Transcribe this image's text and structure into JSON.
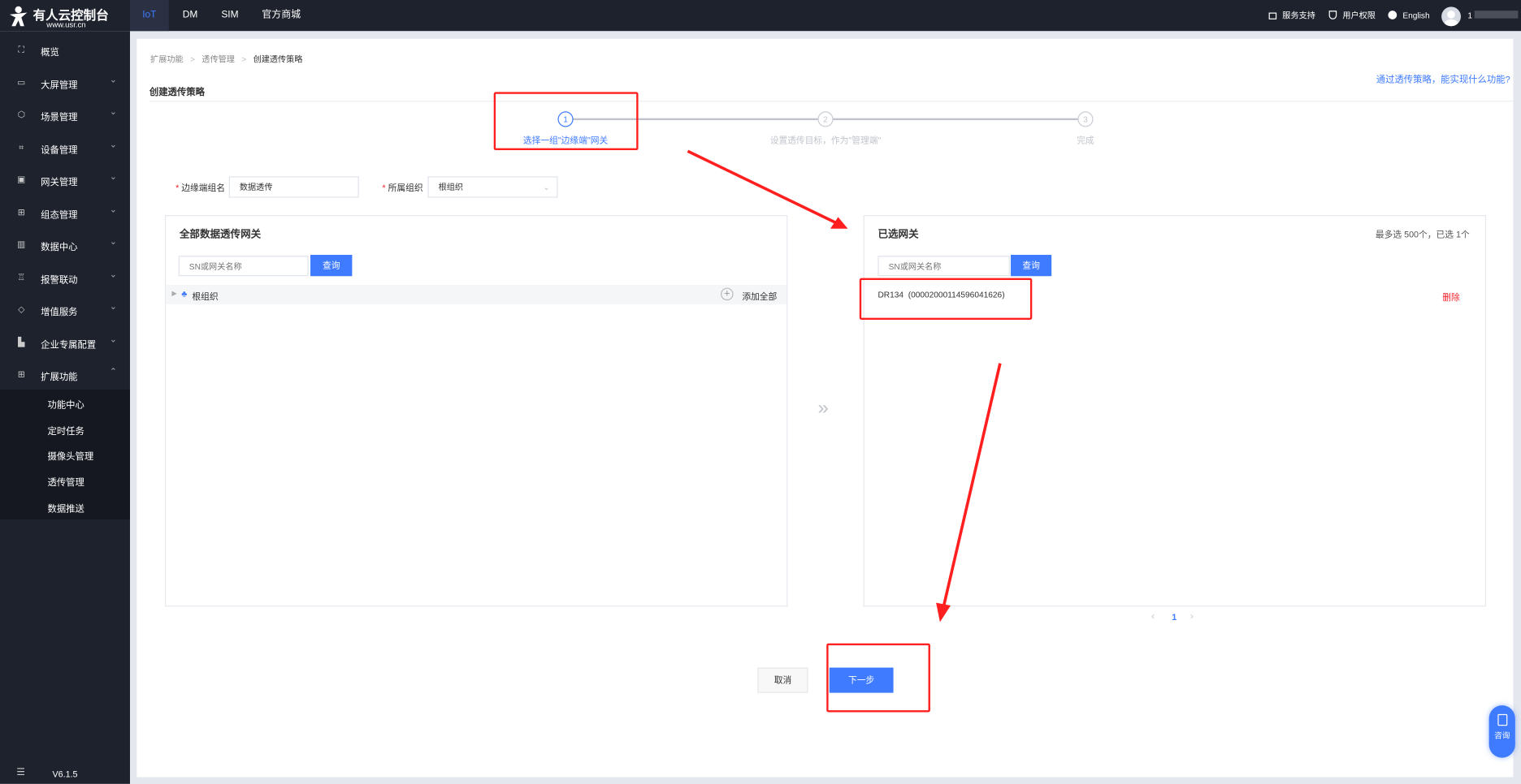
{
  "header": {
    "logo_title": "有人云控制台",
    "logo_url_text": "www.usr.cn",
    "nav": [
      "IoT",
      "DM",
      "SIM",
      "官方商城"
    ],
    "active_nav": "IoT",
    "support": "服务支持",
    "permissions": "用户权限",
    "language": "English",
    "user": "1"
  },
  "sidebar": {
    "items": [
      {
        "label": "概览",
        "icon": "overview-icon"
      },
      {
        "label": "大屏管理",
        "icon": "screen-icon"
      },
      {
        "label": "场景管理",
        "icon": "cube-icon"
      },
      {
        "label": "设备管理",
        "icon": "device-icon"
      },
      {
        "label": "网关管理",
        "icon": "gateway-icon"
      },
      {
        "label": "组态管理",
        "icon": "topology-icon"
      },
      {
        "label": "数据中心",
        "icon": "chart-icon"
      },
      {
        "label": "报警联动",
        "icon": "alarm-icon"
      },
      {
        "label": "增值服务",
        "icon": "diamond-icon"
      },
      {
        "label": "企业专属配置",
        "icon": "building-icon"
      },
      {
        "label": "扩展功能",
        "icon": "grid-icon"
      }
    ],
    "submenu": [
      "功能中心",
      "定时任务",
      "摄像头管理",
      "透传管理",
      "数据推送"
    ],
    "version": "V6.1.5"
  },
  "breadcrumb": [
    "扩展功能",
    "透传管理",
    "创建透传策略"
  ],
  "page_title": "创建透传策略",
  "help_link": "通过透传策略，能实现什么功能?",
  "steps": [
    {
      "num": "1",
      "label": "选择一组\"边缘端\"网关"
    },
    {
      "num": "2",
      "label": "设置透传目标，作为\"管理端\""
    },
    {
      "num": "3",
      "label": "完成"
    }
  ],
  "form": {
    "name_label": "边缘端组名",
    "name_value": "数据透传",
    "org_label": "所属组织",
    "org_value": "根组织",
    "required_mark": "*"
  },
  "left_card": {
    "title": "全部数据透传网关",
    "search_placeholder": "SN或网关名称",
    "search_button": "查询",
    "tree_root": "根组织",
    "add_all": "添加全部"
  },
  "right_card": {
    "title": "已选网关",
    "count_text": "最多选 500个，已选 1个",
    "search_placeholder": "SN或网关名称",
    "search_button": "查询",
    "items": [
      {
        "name": "DR134  (00002000114596041626)",
        "action": "删除"
      }
    ]
  },
  "transfer_icon": "»",
  "pagination": {
    "current": "1"
  },
  "buttons": {
    "cancel": "取消",
    "next": "下一步"
  },
  "consult": "咨询",
  "colors": {
    "primary": "#3f7bff",
    "danger": "#f5222d",
    "annotation": "#ff1f1f"
  }
}
